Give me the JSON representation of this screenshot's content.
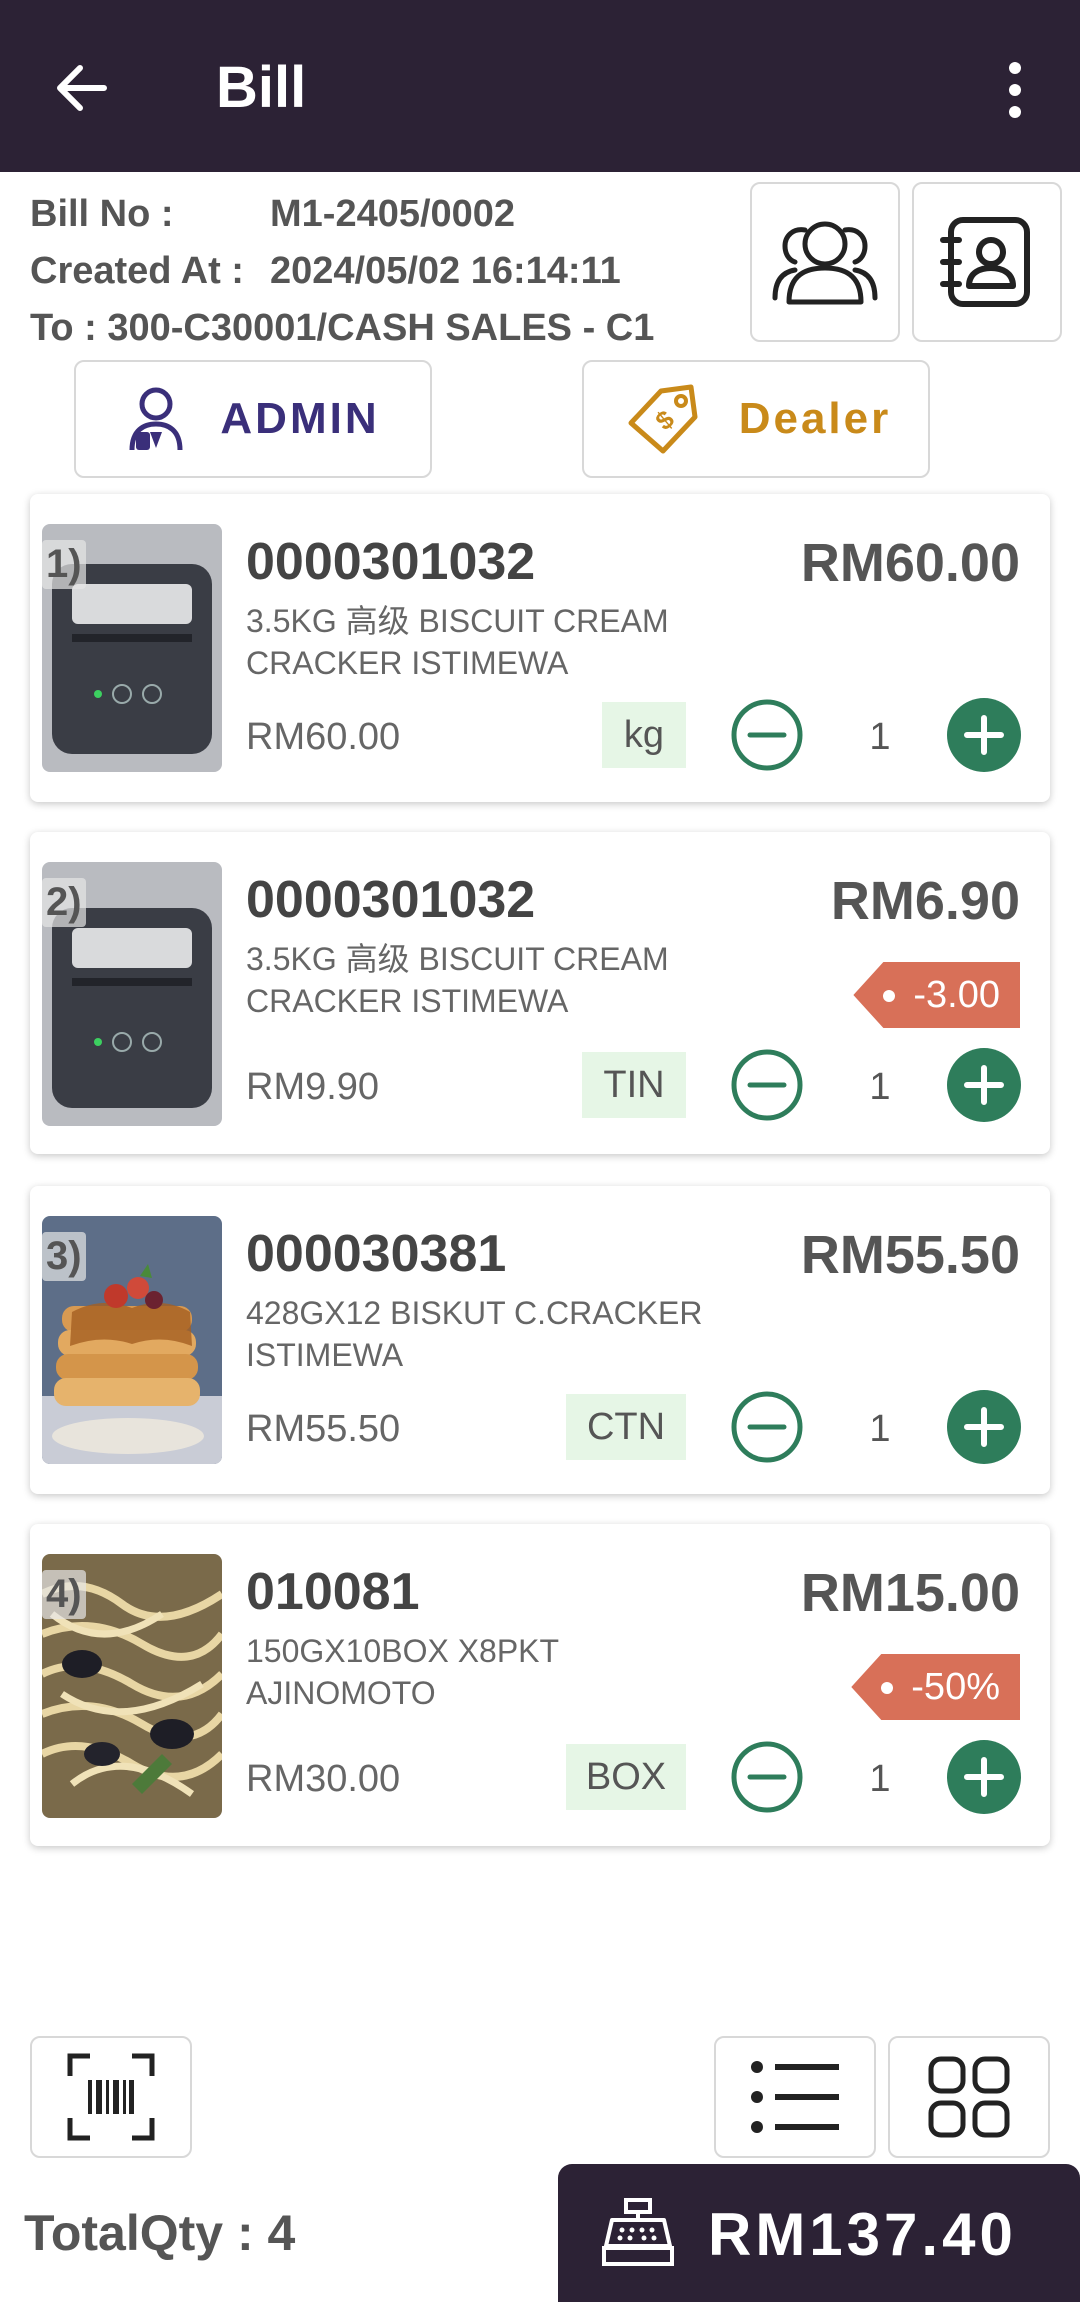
{
  "app_bar": {
    "title": "Bill"
  },
  "bill": {
    "no_label": "Bill No :",
    "no_value": "M1-2405/0002",
    "created_label": "Created At :",
    "created_value": "2024/05/02 16:14:11",
    "to_text": "To : 300-C30001/CASH SALES - C1"
  },
  "buttons": {
    "admin_label": "ADMIN",
    "dealer_label": "Dealer"
  },
  "colors": {
    "header": "#2c2235",
    "plus_green": "#2e7d5b",
    "uom_bg": "#e6f6e6",
    "discount_tag": "#d87058",
    "admin_text": "#3a2f7a",
    "dealer_text": "#c98a1a"
  },
  "items": [
    {
      "index": "1)",
      "code": "0000301032",
      "description": "3.5KG 高级 BISCUIT CREAM CRACKER ISTIMEWA",
      "amount": "RM60.00",
      "unit_price": "RM60.00",
      "uom": "kg",
      "qty": "1",
      "discount": "",
      "image": "mobile-printer"
    },
    {
      "index": "2)",
      "code": "0000301032",
      "description": "3.5KG 高级 BISCUIT CREAM CRACKER ISTIMEWA",
      "amount": "RM6.90",
      "unit_price": "RM9.90",
      "uom": "TIN",
      "qty": "1",
      "discount": "-3.00",
      "image": "mobile-printer"
    },
    {
      "index": "3)",
      "code": "000030381",
      "description": "428GX12 BISKUT C.CRACKER ISTIMEWA",
      "amount": "RM55.50",
      "unit_price": "RM55.50",
      "uom": "CTN",
      "qty": "1",
      "discount": "",
      "image": "pancakes"
    },
    {
      "index": "4)",
      "code": "010081",
      "description": "150GX10BOX X8PKT AJINOMOTO",
      "amount": "RM15.00",
      "unit_price": "RM30.00",
      "uom": "BOX",
      "qty": "1",
      "discount": "-50%",
      "image": "pasta"
    }
  ],
  "footer": {
    "total_qty_label": "TotalQty : 4",
    "total_amount": "RM137.40"
  }
}
